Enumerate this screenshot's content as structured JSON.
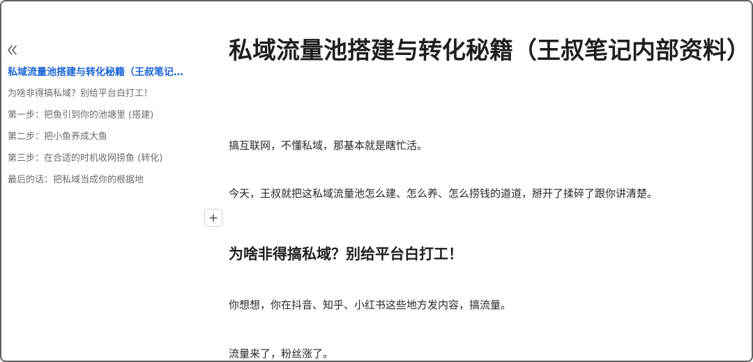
{
  "sidebar": {
    "collapse_icon": "double-chevron-left-icon",
    "toc_items": [
      "私域流量池搭建与转化秘籍（王叔笔记内部资料）",
      "为啥非得搞私域？别给平台白打工！",
      "第一步：把鱼引到你的池塘里 (搭建)",
      "第二步：把小鱼养成大鱼",
      "第三步：在合适的时机收网捞鱼 (转化)",
      "最后的话：把私域当成你的根据地"
    ],
    "active_color": "#1a63d6"
  },
  "editor": {
    "add_block_icon": "plus-icon"
  },
  "doc": {
    "title": "私域流量池搭建与转化秘籍（王叔笔记内部资料）",
    "paragraphs": [
      "搞互联网，不懂私域，那基本就是瞎忙活。",
      "今天，王叔就把这私域流量池怎么建、怎么养、怎么捞钱的道道，掰开了揉碎了跟你讲清楚。"
    ],
    "section_heading": "为啥非得搞私域？别给平台白打工！",
    "section_paragraphs": [
      "你想想，你在抖音、知乎、小红书这些地方发内容，搞流量。",
      "流量来了，粉丝涨了。"
    ]
  }
}
